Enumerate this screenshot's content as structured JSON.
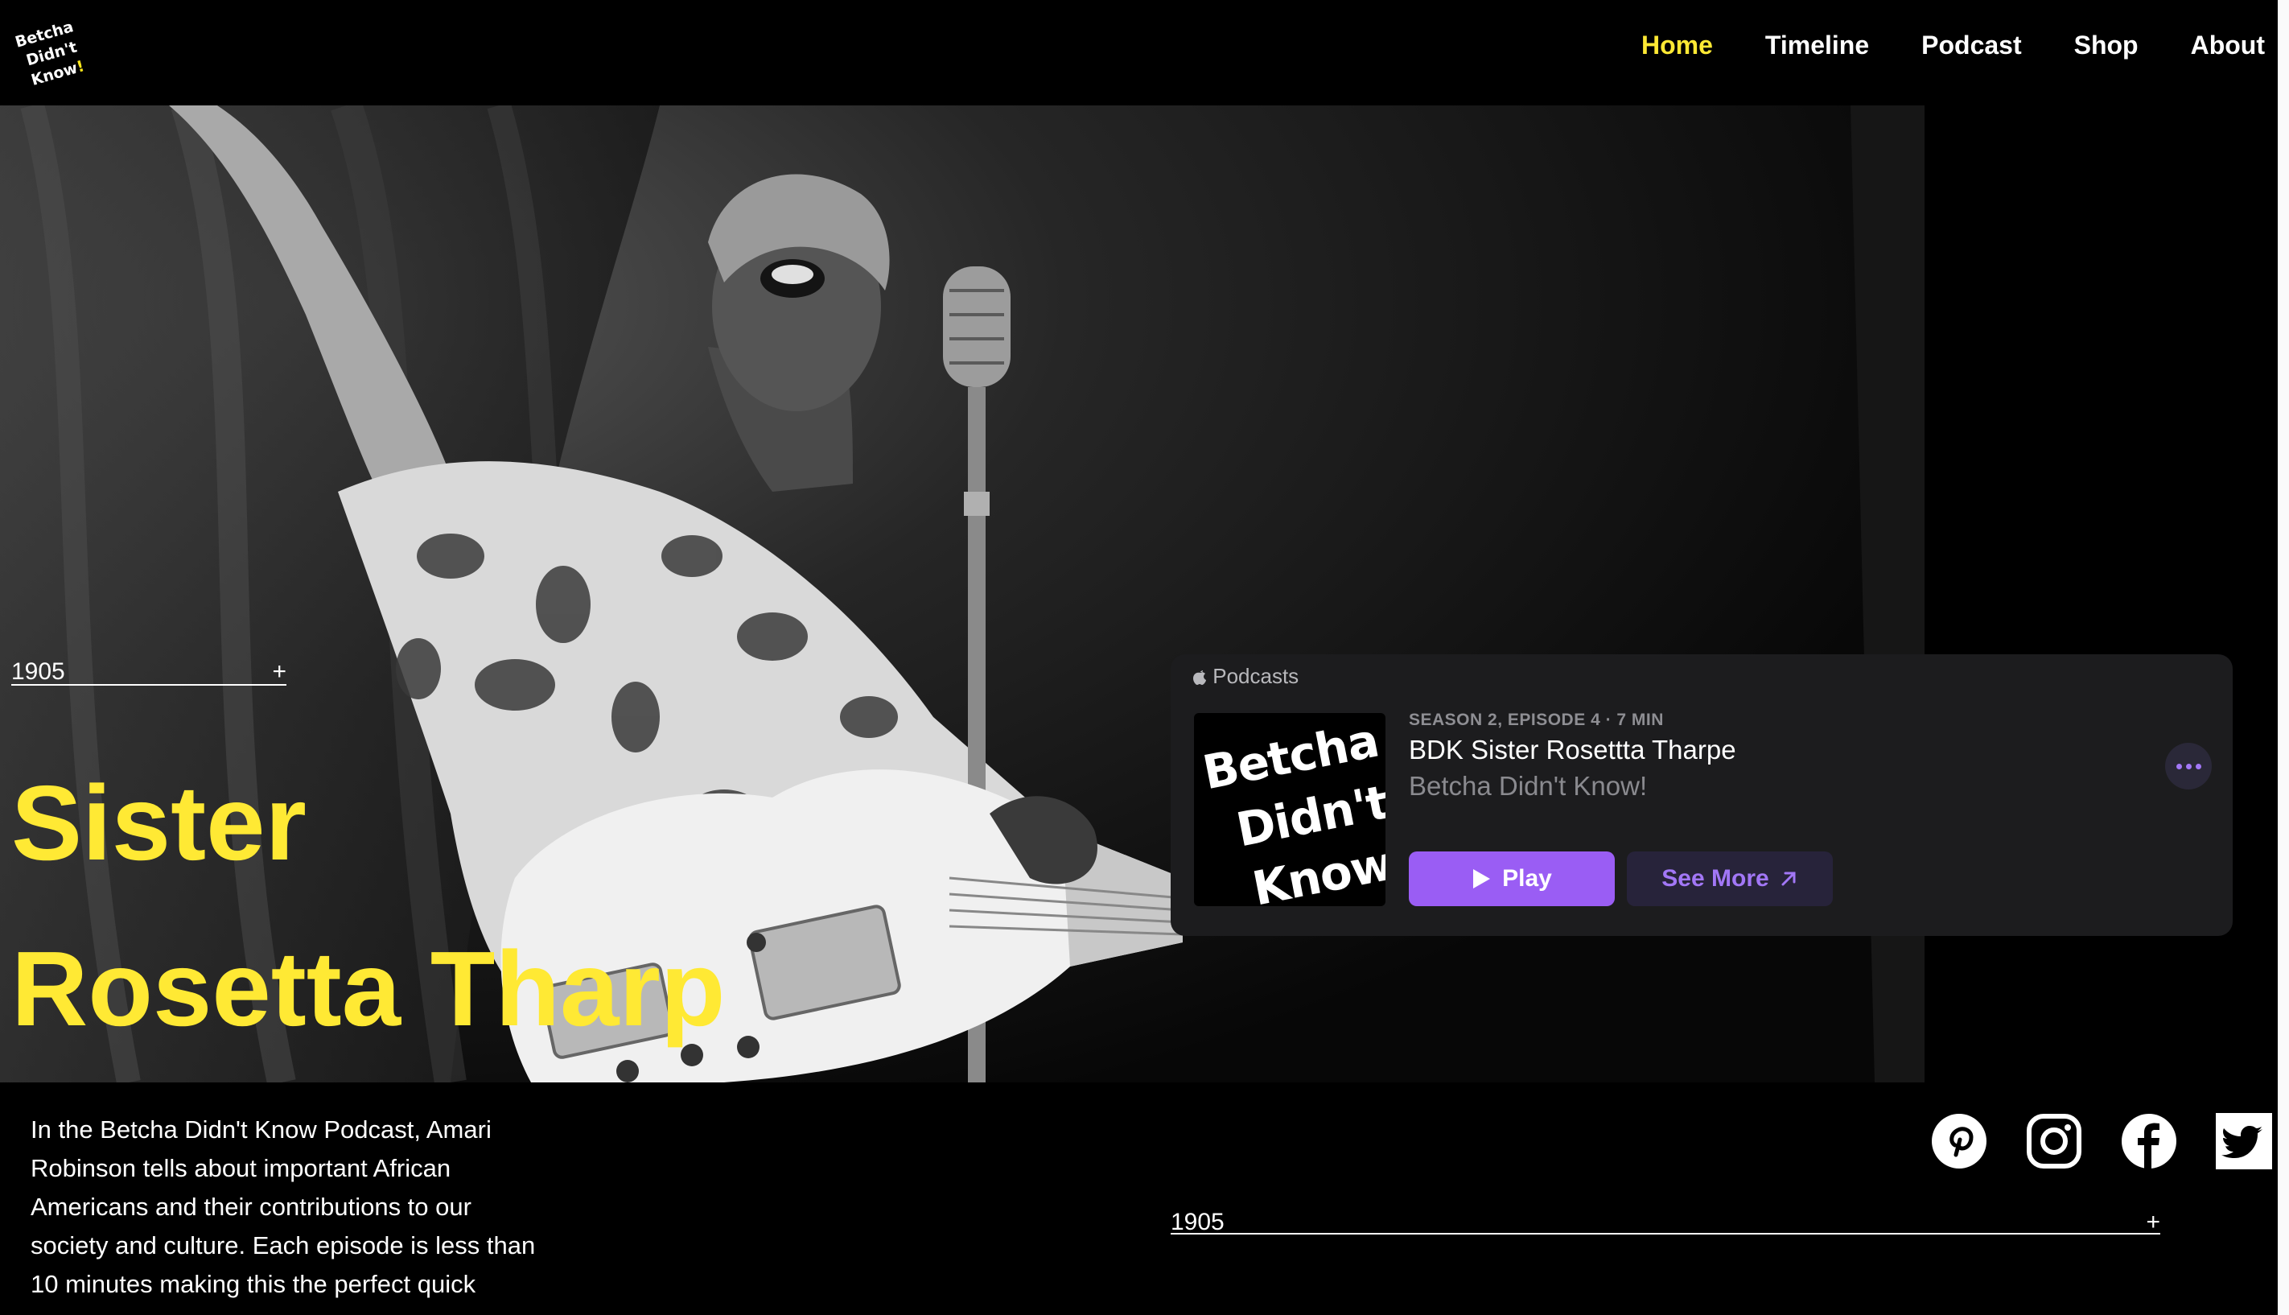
{
  "logo": {
    "line1": "Betcha",
    "line2": "Didn't",
    "line3": "Know",
    "bang": "!"
  },
  "nav": {
    "items": [
      {
        "label": "Home",
        "active": true
      },
      {
        "label": "Timeline",
        "active": false
      },
      {
        "label": "Podcast",
        "active": false
      },
      {
        "label": "Shop",
        "active": false
      },
      {
        "label": "About",
        "active": false
      }
    ]
  },
  "hero": {
    "image": "black-and-white photo of a singer with an electric guitar at a vintage microphone",
    "year_label": "1905",
    "expand_symbol": "+",
    "title_line1": "Sister",
    "title_line2": "Rosetta Tharp"
  },
  "podcast_player": {
    "brand": "Podcasts",
    "art": {
      "line1": "Betcha",
      "line2": "Didn't",
      "line3": "Know",
      "bang": "!"
    },
    "meta": "SEASON 2, EPISODE 4 · 7 MIN",
    "episode_title": "BDK Sister Rosettta Tharpe",
    "show_name": "Betcha Didn't Know!",
    "play_label": "Play",
    "see_more_label": "See More"
  },
  "description": "In the Betcha Didn't Know Podcast, Amari Robinson tells about important African Americans and their contributions to our society and culture. Each episode is less than 10 minutes making this the perfect quick",
  "socials": [
    "pinterest-icon",
    "instagram-icon",
    "facebook-icon",
    "twitter-icon"
  ],
  "footer_year": {
    "label": "1905",
    "expand_symbol": "+"
  },
  "colors": {
    "accent_yellow": "#ffe934",
    "play_purple": "#9a5df4",
    "card_bg": "#1c1c1e"
  }
}
